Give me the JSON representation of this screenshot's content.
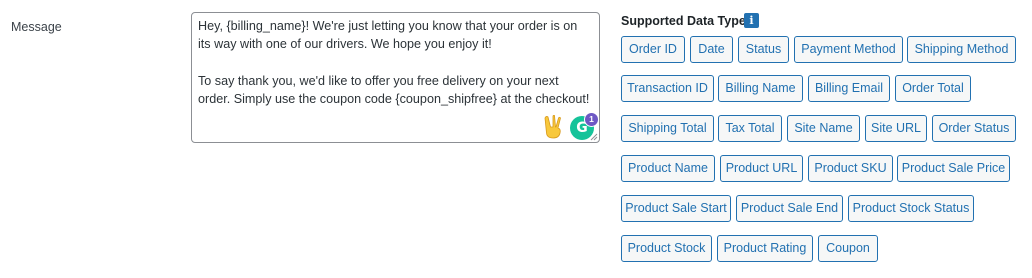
{
  "form": {
    "message_label": "Message",
    "message_value": "Hey, {billing_name}! We're just letting you know that your order is on its way with one of our drivers. We hope you enjoy it!\n\nTo say thank you, we'd like to offer you free delivery on your next order. Simply use the coupon code {coupon_shipfree} at the checkout!",
    "grammarly_letter": "G",
    "grammarly_count": "1"
  },
  "data_types": {
    "title": "Supported Data Types:",
    "info_glyph": "i",
    "tags": [
      "Order ID",
      "Date",
      "Status",
      "Payment Method",
      "Shipping Method",
      "Transaction ID",
      "Billing Name",
      "Billing Email",
      "Order Total",
      "Shipping Total",
      "Tax Total",
      "Site Name",
      "Site URL",
      "Order Status",
      "Product Name",
      "Product URL",
      "Product SKU",
      "Product Sale Price",
      "Product Sale Start",
      "Product Sale End",
      "Product Stock Status",
      "Product Stock",
      "Product Rating",
      "Coupon"
    ]
  },
  "colors": {
    "accent": "#2271b1",
    "grammarly": "#15c39a",
    "grammarly_badge": "#6d58c4"
  },
  "icons": [
    "info-icon",
    "peace-hand-emoji-icon",
    "grammarly-icon",
    "resize-handle-icon"
  ]
}
